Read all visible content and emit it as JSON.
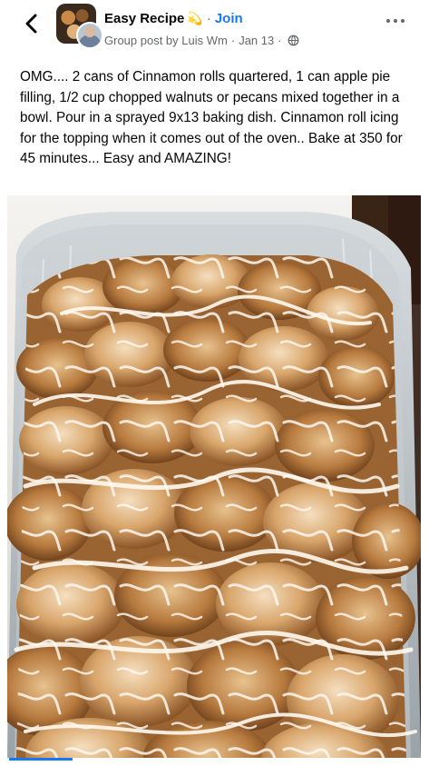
{
  "header": {
    "group_name": "Easy Recipe",
    "group_emoji": "💫",
    "separator": "·",
    "join_label": "Join",
    "post_meta_prefix": "Group post by",
    "author": "Luis Wm",
    "date": "Jan 13",
    "meta_separator": "·"
  },
  "post": {
    "text": "OMG.... 2 cans of Cinnamon rolls quartered, 1 can apple pie filling, 1/2 cup chopped walnuts or pecans mixed together in a bowl. Pour in a sprayed 9x13 baking dish. Cinnamon roll icing for the topping when it comes out of the oven.. Bake at 350 for 45 minutes... Easy and AMAZING!"
  },
  "icons": {
    "back": "chevron-left-icon",
    "more": "more-horizontal-icon",
    "audience": "globe-icon"
  },
  "colors": {
    "accent": "#1877f2",
    "secondary_text": "#65676b"
  }
}
